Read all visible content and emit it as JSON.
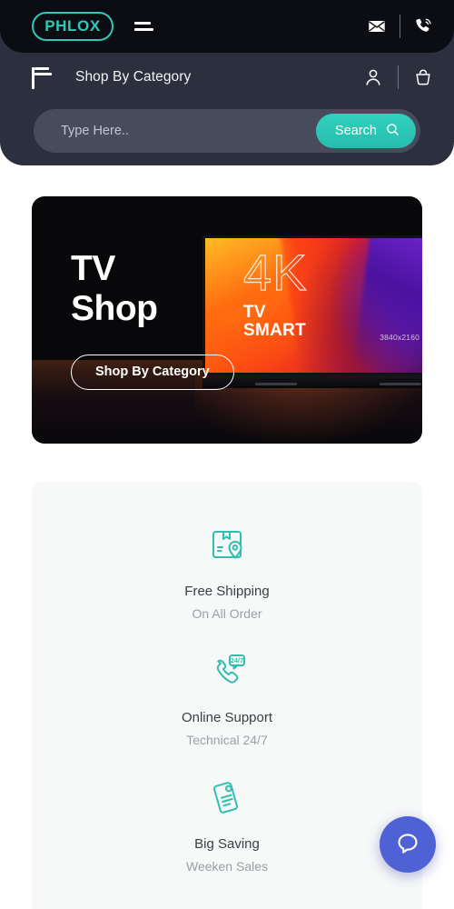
{
  "brand": {
    "logo_text": "PHLOX",
    "accent_color": "#2ec9b8",
    "header_bg": "#2b2f3e",
    "topbar_bg": "#0c0d12"
  },
  "topbar": {
    "menu_icon": "hamburger-icon",
    "mail_icon": "envelope-icon",
    "phone_icon": "phone-ring-icon"
  },
  "navrow": {
    "category_icon": "category-menu-icon",
    "category_label": "Shop By Category",
    "account_icon": "user-icon",
    "cart_icon": "shopping-basket-icon"
  },
  "search": {
    "placeholder": "Type Here..",
    "value": "",
    "button_label": "Search",
    "button_icon": "search-icon"
  },
  "hero": {
    "title_line1": "TV",
    "title_line2": "Shop",
    "button_label": "Shop By Category",
    "tv": {
      "headline": "4K",
      "sub_line1": "TV",
      "sub_line2": "SMART",
      "resolution": "3840x2160 px"
    }
  },
  "features": [
    {
      "icon": "package-location-icon",
      "title": "Free Shipping",
      "subtitle": "On All Order"
    },
    {
      "icon": "phone-support-247-icon",
      "title": "Online Support",
      "subtitle": "Technical 24/7"
    },
    {
      "icon": "price-tag-icon",
      "title": "Big Saving",
      "subtitle": "Weeken Sales"
    }
  ],
  "chat": {
    "icon": "chat-bubble-icon",
    "color": "#4e62d6"
  }
}
